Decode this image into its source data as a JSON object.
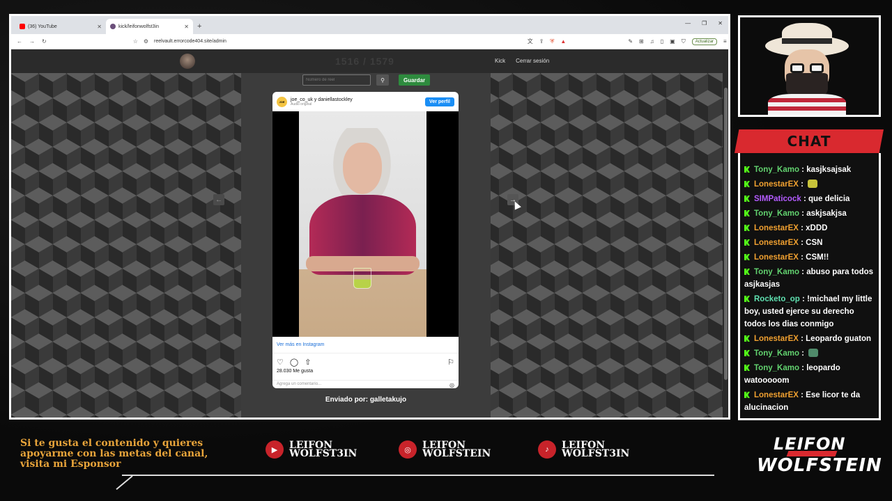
{
  "browser": {
    "tabs": [
      {
        "label": "(36) YouTube",
        "icon": "youtube-icon",
        "color": "#ff0000"
      },
      {
        "label": "kick/leifonwolfst3in",
        "icon": "speaker-icon",
        "color": "#6b4f7a"
      }
    ],
    "new_tab": "+",
    "url": "reelvault.errorcode404.site/admin",
    "update_label": "Actualizar"
  },
  "site": {
    "counter": "1516 / 1579",
    "nav": [
      "Kick",
      "Cerrar sesión"
    ],
    "reel_placeholder": "Número de reel",
    "save_label": "Guardar",
    "sent_by": "Enviado por: galletakujo"
  },
  "instagram": {
    "avatar_text": "JOE",
    "users": "joe_co_uk y daniellastockley",
    "audio": "Audio original",
    "follow_label": "Ver perfil",
    "more_link": "Ver más en Instagram",
    "likes": "28.030 Me gusta",
    "comment_placeholder": "Agrega un comentario..."
  },
  "chat": {
    "title": "CHAT",
    "messages": [
      {
        "user": "Tony_Kamo",
        "color": "#62d26f",
        "text": "kasjksajsak"
      },
      {
        "user": "LonestarEX",
        "color": "#f0a030",
        "text": "",
        "emote": "#c8c43a"
      },
      {
        "user": "SIMPaticock",
        "color": "#b45bff",
        "text": "que delicia"
      },
      {
        "user": "Tony_Kamo",
        "color": "#62d26f",
        "text": "askjsakjsa"
      },
      {
        "user": "LonestarEX",
        "color": "#f0a030",
        "text": "xDDD"
      },
      {
        "user": "LonestarEX",
        "color": "#f0a030",
        "text": "CSN"
      },
      {
        "user": "LonestarEX",
        "color": "#f0a030",
        "text": "CSM!!"
      },
      {
        "user": "Tony_Kamo",
        "color": "#62d26f",
        "text": "abuso para todos asjkasjas"
      },
      {
        "user": "Rocketo_op",
        "color": "#5fe0b0",
        "text": "!michael my little boy, usted ejerce su derecho todos los dias conmigo"
      },
      {
        "user": "LonestarEX",
        "color": "#f0a030",
        "text": "Leopardo guaton"
      },
      {
        "user": "Tony_Kamo",
        "color": "#62d26f",
        "text": "",
        "emote": "#4f8a6a"
      },
      {
        "user": "Tony_Kamo",
        "color": "#62d26f",
        "text": "leopardo watooooom"
      },
      {
        "user": "LonestarEX",
        "color": "#f0a030",
        "text": "Ese licor te da alucinacion"
      }
    ]
  },
  "overlay": {
    "promo": "Si te gusta el contenido y quieres apoyarme con las metas del canal, visita mi Esponsor",
    "socials": [
      {
        "icon": "youtube-icon",
        "name": "LEIFON WOLFST3IN"
      },
      {
        "icon": "instagram-icon",
        "name": "LEIFON WOLFSTEIN"
      },
      {
        "icon": "tiktok-icon",
        "name": "LEIFON WOLFST3IN"
      }
    ],
    "brand_top": "LEIFON",
    "brand_bottom": "WOLFSTEIN"
  }
}
